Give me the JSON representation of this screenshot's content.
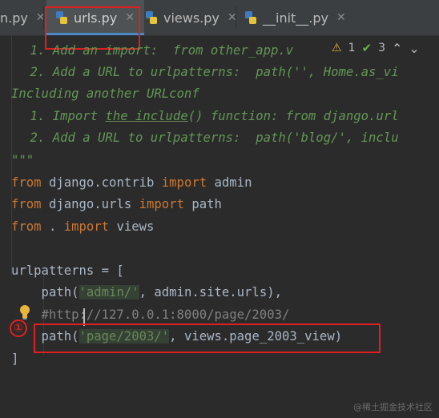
{
  "tabs": [
    {
      "label": "n.py",
      "active": false
    },
    {
      "label": "urls.py",
      "active": true
    },
    {
      "label": "views.py",
      "active": false
    },
    {
      "label": "__init__.py",
      "active": false
    }
  ],
  "inspection": {
    "warnings": "1",
    "ok": "3"
  },
  "code": {
    "l1": "    1. Add an import:  from other_app.v",
    "l2": "    2. Add a URL to urlpatterns:  path('', Home.as_vi",
    "l3": "Including another URLconf",
    "l4a": "    1. Import ",
    "l4b": "the include",
    "l4c": "() function: from django.url",
    "l5": "    2. Add a URL to urlpatterns:  path('blog/', inclu",
    "l6": "\"\"\"",
    "l7_kw1": "from",
    "l7_mid": " django.contrib ",
    "l7_kw2": "import",
    "l7_end": " admin",
    "l8_kw1": "from",
    "l8_mid": " django.urls ",
    "l8_kw2": "import",
    "l8_end": " path",
    "l9_kw1": "from",
    "l9_mid": " . ",
    "l9_kw2": "import",
    "l9_end": " views",
    "l11": "urlpatterns = [",
    "l12a": "    path(",
    "l12b": "'admin/'",
    "l12c": ", admin.site.urls),",
    "l13": "    #http://127.0.0.1:8000/page/2003/",
    "l14a": "    path(",
    "l14b": "'page/2003/'",
    "l14c": ", views.page_2003_view)",
    "l15": "]"
  },
  "annotation": {
    "number": "①"
  },
  "watermark": "@稀土掘金技术社区",
  "colors": {
    "keyword": "#cc7832",
    "string": "#6a8759",
    "docstring": "#629755",
    "comment": "#808080",
    "annotation": "#e02020"
  }
}
